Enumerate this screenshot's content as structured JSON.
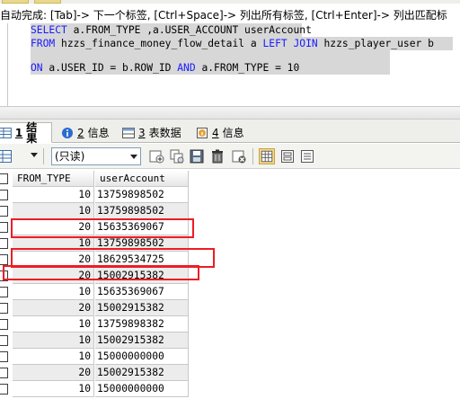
{
  "hint": "自动完成: [Tab]-> 下一个标签, [Ctrl+Space]-> 列出所有标签, [Ctrl+Enter]-> 列出匹配标",
  "sql": {
    "line1": {
      "kw1": "SELECT",
      "rest": " a.FROM_TYPE ,a.USER_ACCOUNT userAccount"
    },
    "line2": {
      "kw1": "FROM",
      "mid": " hzzs_finance_money_flow_detail a ",
      "kw2": "LEFT JOIN",
      "rest": " hzzs_player_user b"
    },
    "line3": {
      "kw1": "ON",
      "mid": " a.USER_ID = b.ROW_ID ",
      "kw2": "AND",
      "rest": " a.FROM_TYPE = 10"
    }
  },
  "tabs": [
    {
      "num": "1",
      "label": "结果"
    },
    {
      "num": "2",
      "label": "信息"
    },
    {
      "num": "3",
      "label": "表数据"
    },
    {
      "num": "4",
      "label": "信息"
    }
  ],
  "toolbar": {
    "readonly_label": "(只读)"
  },
  "grid": {
    "columns": [
      "FROM_TYPE",
      "userAccount"
    ],
    "rows": [
      {
        "from_type": "10",
        "account": "13759898502"
      },
      {
        "from_type": "10",
        "account": "13759898502"
      },
      {
        "from_type": "20",
        "account": "15635369067"
      },
      {
        "from_type": "10",
        "account": "13759898502"
      },
      {
        "from_type": "20",
        "account": "18629534725"
      },
      {
        "from_type": "20",
        "account": "15002915382"
      },
      {
        "from_type": "10",
        "account": "15635369067"
      },
      {
        "from_type": "20",
        "account": "15002915382"
      },
      {
        "from_type": "10",
        "account": "13759898382"
      },
      {
        "from_type": "10",
        "account": "15002915382"
      },
      {
        "from_type": "10",
        "account": "15000000000"
      },
      {
        "from_type": "20",
        "account": "15002915382"
      },
      {
        "from_type": "10",
        "account": "15000000000"
      }
    ]
  },
  "colors": {
    "keyword": "#1a1aff",
    "annotation": "#ee1c24",
    "selection": "#d7d7d7"
  }
}
